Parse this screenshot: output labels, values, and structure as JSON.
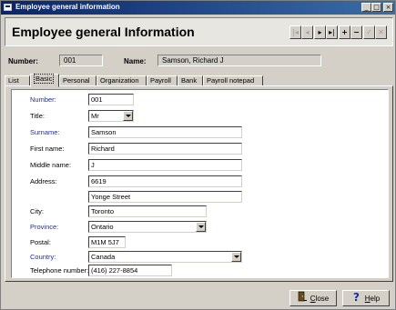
{
  "window": {
    "title": "Employee general information"
  },
  "header": {
    "heading": "Employee general Information"
  },
  "id_bar": {
    "number_label": "Number:",
    "number_value": "001",
    "name_label": "Name:",
    "name_value": "Samson, Richard J"
  },
  "tabs": [
    "List",
    "Basic",
    "Personal",
    "Organization",
    "Payroll",
    "Bank",
    "Payroll notepad"
  ],
  "form": {
    "number": {
      "label": "Number:",
      "value": "001"
    },
    "title": {
      "label": "Title:",
      "value": "Mr"
    },
    "surname": {
      "label": "Surname:",
      "value": "Samson"
    },
    "first_name": {
      "label": "First name:",
      "value": "Richard"
    },
    "middle_name": {
      "label": "Middle name:",
      "value": "J"
    },
    "address": {
      "label": "Address:",
      "line1": "6619",
      "line2": "Yonge Street"
    },
    "city": {
      "label": "City:",
      "value": "Toronto"
    },
    "province": {
      "label": "Province:",
      "value": "Ontario"
    },
    "postal": {
      "label": "Postal:",
      "value": "M1M 5J7"
    },
    "country": {
      "label": "Country:",
      "value": "Canada"
    },
    "telephone": {
      "label": "Telephone number:",
      "value": "(416) 227-8854"
    }
  },
  "buttons": {
    "close": {
      "label_pre": "",
      "label_ul": "C",
      "label_post": "lose"
    },
    "help": {
      "label_pre": "",
      "label_ul": "H",
      "label_post": "elp"
    }
  },
  "colors": {
    "required_label": "#1c2aa8",
    "titlebar": "#0a246a"
  },
  "icons": [
    "minimize-icon",
    "maximize-icon",
    "close-icon",
    "first-record-icon",
    "previous-record-icon",
    "next-record-icon",
    "last-record-icon",
    "add-record-icon",
    "delete-record-icon",
    "save-record-icon",
    "cancel-record-icon",
    "door-exit-icon",
    "question-help-icon"
  ]
}
